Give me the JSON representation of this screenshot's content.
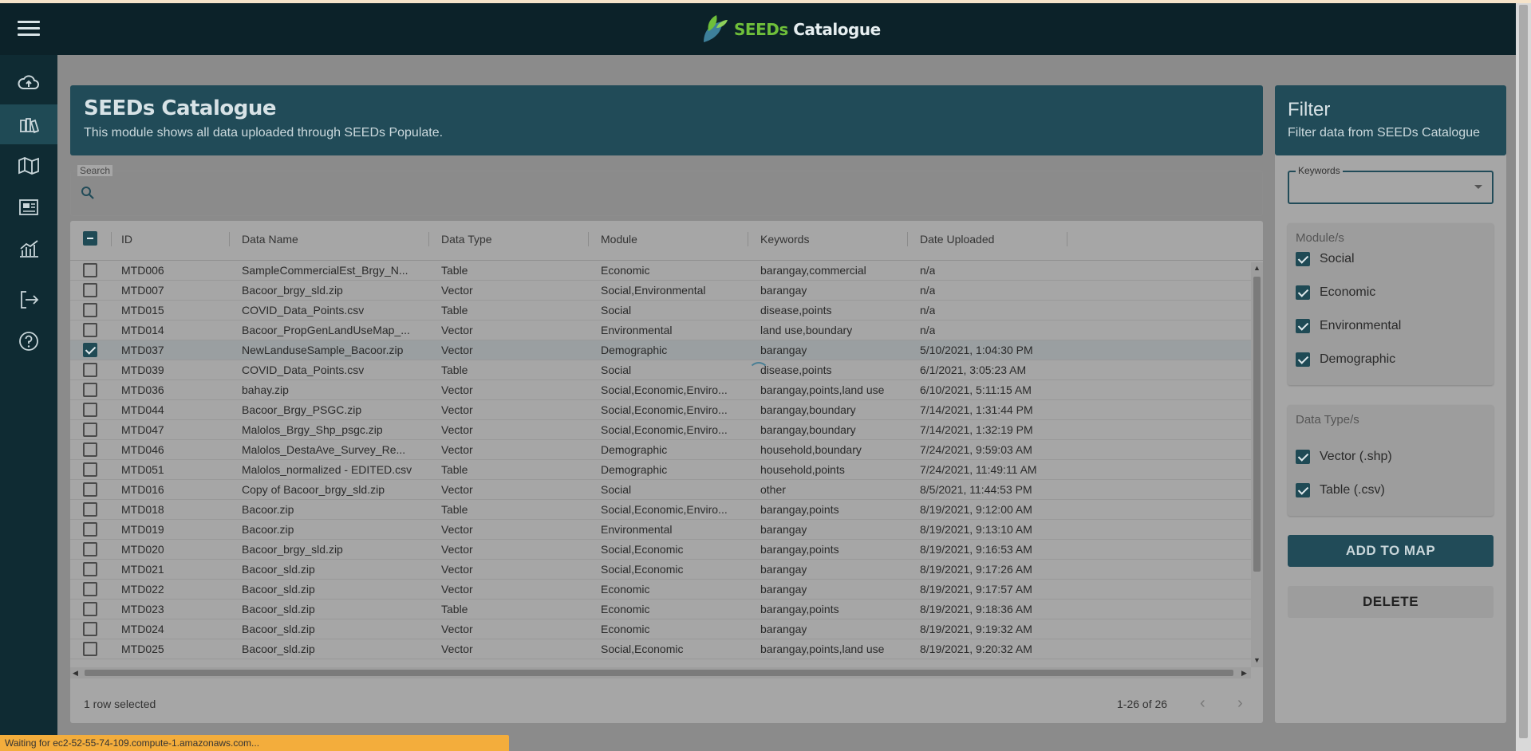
{
  "app": {
    "logo_prefix": "SEEDs",
    "logo_suffix": " Catalogue"
  },
  "sidebar": {
    "items": [
      {
        "name": "upload",
        "icon": "cloud-upload-icon"
      },
      {
        "name": "catalogue",
        "icon": "books-icon",
        "active": true
      },
      {
        "name": "map",
        "icon": "map-icon"
      },
      {
        "name": "dashboard",
        "icon": "dashboard-icon"
      },
      {
        "name": "analytics",
        "icon": "chart-icon"
      },
      {
        "name": "logout",
        "icon": "logout-icon"
      },
      {
        "name": "help",
        "icon": "help-icon"
      }
    ]
  },
  "main": {
    "title": "SEEDs Catalogue",
    "subtitle": "This module shows all data uploaded through SEEDs Populate.",
    "search": {
      "label": "Search",
      "value": "",
      "placeholder": ""
    }
  },
  "table": {
    "columns": [
      "ID",
      "Data Name",
      "Data Type",
      "Module",
      "Keywords",
      "Date Uploaded"
    ],
    "rows": [
      {
        "id": "MTD006",
        "name": "SampleCommercialEst_Brgy_N...",
        "type": "Table",
        "module": "Economic",
        "keywords": "barangay,commercial",
        "date": "n/a",
        "checked": false
      },
      {
        "id": "MTD007",
        "name": "Bacoor_brgy_sld.zip",
        "type": "Vector",
        "module": "Social,Environmental",
        "keywords": "barangay",
        "date": "n/a",
        "checked": false
      },
      {
        "id": "MTD015",
        "name": "COVID_Data_Points.csv",
        "type": "Table",
        "module": "Social",
        "keywords": "disease,points",
        "date": "n/a",
        "checked": false
      },
      {
        "id": "MTD014",
        "name": "Bacoor_PropGenLandUseMap_...",
        "type": "Vector",
        "module": "Environmental",
        "keywords": "land use,boundary",
        "date": "n/a",
        "checked": false
      },
      {
        "id": "MTD037",
        "name": "NewLanduseSample_Bacoor.zip",
        "type": "Vector",
        "module": "Demographic",
        "keywords": "barangay",
        "date": "5/10/2021, 1:04:30 PM",
        "checked": true
      },
      {
        "id": "MTD039",
        "name": "COVID_Data_Points.csv",
        "type": "Table",
        "module": "Social",
        "keywords": "disease,points",
        "date": "6/1/2021, 3:05:23 AM",
        "checked": false
      },
      {
        "id": "MTD036",
        "name": "bahay.zip",
        "type": "Vector",
        "module": "Social,Economic,Enviro...",
        "keywords": "barangay,points,land use",
        "date": "6/10/2021, 5:11:15 AM",
        "checked": false
      },
      {
        "id": "MTD044",
        "name": "Bacoor_Brgy_PSGC.zip",
        "type": "Vector",
        "module": "Social,Economic,Enviro...",
        "keywords": "barangay,boundary",
        "date": "7/14/2021, 1:31:44 PM",
        "checked": false
      },
      {
        "id": "MTD047",
        "name": "Malolos_Brgy_Shp_psgc.zip",
        "type": "Vector",
        "module": "Social,Economic,Enviro...",
        "keywords": "barangay,boundary",
        "date": "7/14/2021, 1:32:19 PM",
        "checked": false
      },
      {
        "id": "MTD046",
        "name": "Malolos_DestaAve_Survey_Re...",
        "type": "Vector",
        "module": "Demographic",
        "keywords": "household,boundary",
        "date": "7/24/2021, 9:59:03 AM",
        "checked": false
      },
      {
        "id": "MTD051",
        "name": "Malolos_normalized - EDITED.csv",
        "type": "Table",
        "module": "Demographic",
        "keywords": "household,points",
        "date": "7/24/2021, 11:49:11 AM",
        "checked": false
      },
      {
        "id": "MTD016",
        "name": "Copy of Bacoor_brgy_sld.zip",
        "type": "Vector",
        "module": "Social",
        "keywords": "other",
        "date": "8/5/2021, 11:44:53 PM",
        "checked": false
      },
      {
        "id": "MTD018",
        "name": "Bacoor.zip",
        "type": "Table",
        "module": "Social,Economic,Enviro...",
        "keywords": "barangay,points",
        "date": "8/19/2021, 9:12:00 AM",
        "checked": false
      },
      {
        "id": "MTD019",
        "name": "Bacoor.zip",
        "type": "Vector",
        "module": "Environmental",
        "keywords": "barangay",
        "date": "8/19/2021, 9:13:10 AM",
        "checked": false
      },
      {
        "id": "MTD020",
        "name": "Bacoor_brgy_sld.zip",
        "type": "Vector",
        "module": "Social,Economic",
        "keywords": "barangay,points",
        "date": "8/19/2021, 9:16:53 AM",
        "checked": false
      },
      {
        "id": "MTD021",
        "name": "Bacoor_sld.zip",
        "type": "Vector",
        "module": "Social,Economic",
        "keywords": "barangay",
        "date": "8/19/2021, 9:17:26 AM",
        "checked": false
      },
      {
        "id": "MTD022",
        "name": "Bacoor_sld.zip",
        "type": "Vector",
        "module": "Economic",
        "keywords": "barangay",
        "date": "8/19/2021, 9:17:57 AM",
        "checked": false
      },
      {
        "id": "MTD023",
        "name": "Bacoor_sld.zip",
        "type": "Table",
        "module": "Economic",
        "keywords": "barangay,points",
        "date": "8/19/2021, 9:18:36 AM",
        "checked": false
      },
      {
        "id": "MTD024",
        "name": "Bacoor_sld.zip",
        "type": "Vector",
        "module": "Economic",
        "keywords": "barangay",
        "date": "8/19/2021, 9:19:32 AM",
        "checked": false
      },
      {
        "id": "MTD025",
        "name": "Bacoor_sld.zip",
        "type": "Vector",
        "module": "Social,Economic",
        "keywords": "barangay,points,land use",
        "date": "8/19/2021, 9:20:32 AM",
        "checked": false
      }
    ],
    "footer": {
      "selected": "1 row selected",
      "range": "1-26 of 26"
    }
  },
  "filter": {
    "title": "Filter",
    "subtitle": "Filter data from SEEDs Catalogue",
    "keywords_label": "Keywords",
    "modules": {
      "title": "Module/s",
      "options": [
        {
          "label": "Social",
          "checked": true
        },
        {
          "label": "Economic",
          "checked": true
        },
        {
          "label": "Environmental",
          "checked": true
        },
        {
          "label": "Demographic",
          "checked": true
        }
      ]
    },
    "data_types": {
      "title": "Data Type/s",
      "options": [
        {
          "label": "Vector (.shp)",
          "checked": true
        },
        {
          "label": "Table (.csv)",
          "checked": true
        }
      ]
    },
    "add_button": "ADD TO MAP",
    "delete_button": "DELETE"
  },
  "status": {
    "text": "Waiting for ec2-52-55-74-109.compute-1.amazonaws.com..."
  },
  "colors": {
    "accent": "#214b58",
    "sidebar": "#0f2b33",
    "topbar": "#0c2229",
    "logo_green": "#6fbf3a",
    "status": "#f3ad3c"
  }
}
